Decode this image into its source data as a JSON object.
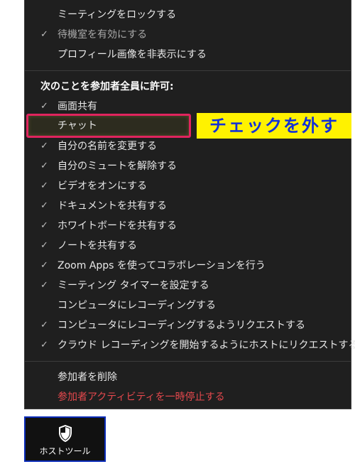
{
  "menu": {
    "top_items": [
      {
        "label": "ミーティングをロックする",
        "checked": false
      },
      {
        "label": "待機室を有効にする",
        "checked": true
      },
      {
        "label": "プロフィール画像を非表示にする",
        "checked": false
      }
    ],
    "allow_header": "次のことを参加者全員に許可:",
    "allow_items": [
      {
        "label": "画面共有",
        "checked": true
      },
      {
        "label": "チャット",
        "checked": false
      },
      {
        "label": "自分の名前を変更する",
        "checked": true
      },
      {
        "label": "自分のミュートを解除する",
        "checked": true
      },
      {
        "label": "ビデオをオンにする",
        "checked": true
      },
      {
        "label": "ドキュメントを共有する",
        "checked": true
      },
      {
        "label": "ホワイトボードを共有する",
        "checked": true
      },
      {
        "label": "ノートを共有する",
        "checked": true
      },
      {
        "label": "Zoom Apps を使ってコラボレーションを行う",
        "checked": true
      },
      {
        "label": "ミーティング タイマーを設定する",
        "checked": true
      },
      {
        "label": "コンピュータにレコーディングする",
        "checked": false
      },
      {
        "label": "コンピュータにレコーディングするようリクエストする",
        "checked": true
      },
      {
        "label": "クラウド レコーディングを開始するようにホストにリクエストする",
        "checked": true
      }
    ],
    "bottom_items": [
      {
        "label": "参加者を削除",
        "red": false
      },
      {
        "label": "参加者アクティビティを一時停止する",
        "red": true
      }
    ],
    "checkmark": "✓"
  },
  "annotation": {
    "callout_text": "チェックを外す",
    "highlight_color": "#e0245e",
    "callout_bg": "#fff200",
    "callout_color": "#1230d8"
  },
  "host_tools": {
    "label": "ホストツール",
    "icon": "shield-icon"
  }
}
